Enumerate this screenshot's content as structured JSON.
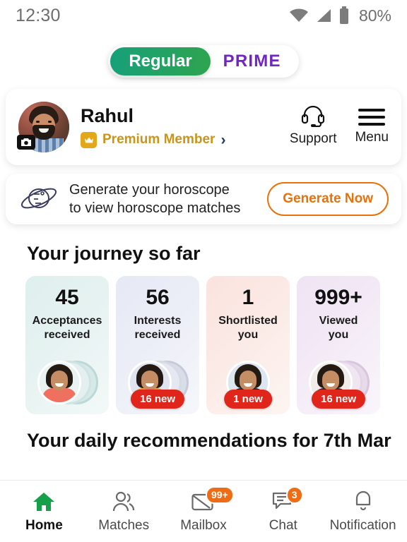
{
  "status_bar": {
    "time": "12:30",
    "battery_percent": "80%",
    "icons": [
      "wifi-icon",
      "signal-icon",
      "battery-icon"
    ]
  },
  "toggle": {
    "regular_label": "Regular",
    "prime_label": "PRIME",
    "active": "Regular",
    "regular_color": "#16a07a",
    "prime_color": "#7126c4"
  },
  "profile": {
    "name": "Rahul",
    "membership": "Premium Member",
    "membership_color": "#c9951a",
    "chevron": "›",
    "support_label": "Support",
    "menu_label": "Menu"
  },
  "horoscope": {
    "line1": "Generate your horoscope",
    "line2": "to view horoscope matches",
    "button_label": "Generate Now",
    "button_color": "#e8710a"
  },
  "journey": {
    "title": "Your journey so far",
    "cards": [
      {
        "count": "45",
        "label_line1": "Acceptances",
        "label_line2": "received",
        "badge": "",
        "bg": "#dff0ee",
        "thumb_bg": "#e8f3f2",
        "outfit": "#f0705f"
      },
      {
        "count": "56",
        "label_line1": "Interests",
        "label_line2": "received",
        "badge": "16 new",
        "bg": "#e6e9f5",
        "thumb_bg": "#dfe4ee",
        "outfit": "#e8a51c"
      },
      {
        "count": "1",
        "label_line1": "Shortlisted",
        "label_line2": "you",
        "badge": "1 new",
        "bg": "#fbe3de",
        "thumb_bg": "#dce6ef",
        "outfit": "#1d2a3a"
      },
      {
        "count": "999+",
        "label_line1": "Viewed",
        "label_line2": "you",
        "badge": "16 new",
        "bg": "#f0e4f3",
        "thumb_bg": "#f1ece9",
        "outfit": "#2b2b33"
      }
    ]
  },
  "recommendations": {
    "title": "Your daily recommendations for 7th Mar"
  },
  "bottom_nav": {
    "items": [
      {
        "label": "Home",
        "icon": "home-icon",
        "badge": "",
        "active": true
      },
      {
        "label": "Matches",
        "icon": "people-icon",
        "badge": "",
        "active": false
      },
      {
        "label": "Mailbox",
        "icon": "envelope-icon",
        "badge": "99+",
        "active": false
      },
      {
        "label": "Chat",
        "icon": "chat-bubble-icon",
        "badge": "3",
        "active": false
      },
      {
        "label": "Notification",
        "icon": "bell-icon",
        "badge": "",
        "active": false
      }
    ],
    "active_color": "#17a04a",
    "badge_color": "#ef6c16"
  }
}
